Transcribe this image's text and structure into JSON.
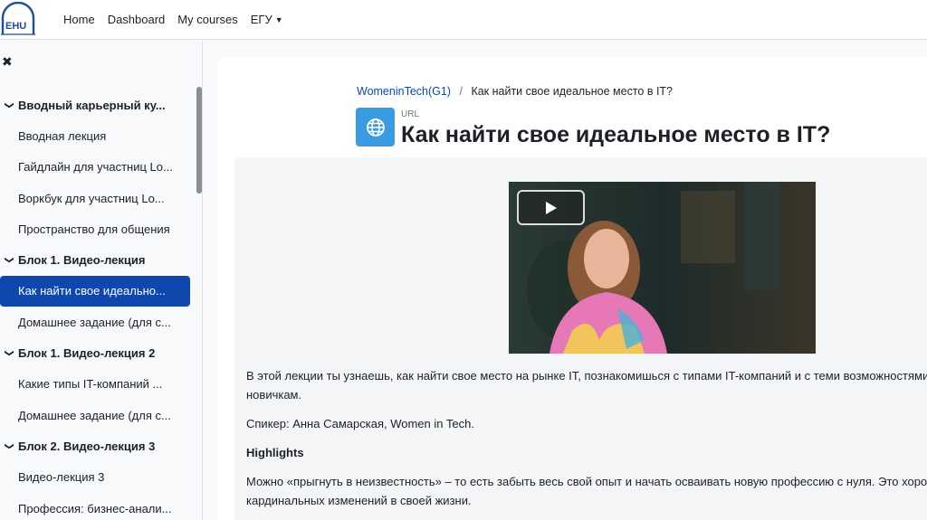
{
  "navbar": {
    "logo_text": "EHU",
    "links": [
      "Home",
      "Dashboard",
      "My courses"
    ],
    "dropdown_label": "ЕГУ"
  },
  "drawer": {
    "close_icon": "close-icon",
    "items": [
      {
        "type": "section",
        "label": "Вводный карьерный ку..."
      },
      {
        "type": "child",
        "label": "Вводная лекция"
      },
      {
        "type": "child",
        "label": "Гайдлайн для участниц Lo..."
      },
      {
        "type": "child",
        "label": "Воркбук для участниц Lo..."
      },
      {
        "type": "child",
        "label": "Пространство для общения"
      },
      {
        "type": "section",
        "label": "Блок 1. Видео-лекция"
      },
      {
        "type": "child",
        "label": "Как найти свое идеально...",
        "active": true
      },
      {
        "type": "child",
        "label": "Домашнее задание (для с..."
      },
      {
        "type": "section",
        "label": "Блок 1. Видео-лекция 2"
      },
      {
        "type": "child",
        "label": "Какие типы IT-компаний ..."
      },
      {
        "type": "child",
        "label": "Домашнее задание (для с..."
      },
      {
        "type": "section",
        "label": "Блок 2. Видео-лекция 3"
      },
      {
        "type": "child",
        "label": "Видео-лекция 3"
      },
      {
        "type": "child",
        "label": "Профессия: бизнес-анали..."
      }
    ]
  },
  "breadcrumb": {
    "course": "WomeninTech(G1)",
    "separator": "/",
    "current": "Как найти свое идеальное место в IT?"
  },
  "module": {
    "type_label": "URL",
    "title": "Как найти свое идеальное место в IT?",
    "icon": "globe-icon",
    "icon_color": "#399be2"
  },
  "content": {
    "intro_line1": "В этой лекции ты узнаешь, как найти свое место на рынке IT, познакомишься с типами IT-компаний и с теми возможностями, ко",
    "intro_line2": "новичкам.",
    "speaker": "Спикер: Анна Самарская, Women in Tech.",
    "highlights_heading": "Highlights",
    "highlight_line1": "Можно «прыгнуть в неизвестность» – то есть забыть весь свой опыт и начать осваивать новую профессию с нуля. Это хороший",
    "highlight_line2": "кардинальных изменений в своей жизни."
  },
  "colors": {
    "accent": "#0f47ad",
    "brand": "#1f4e96"
  }
}
